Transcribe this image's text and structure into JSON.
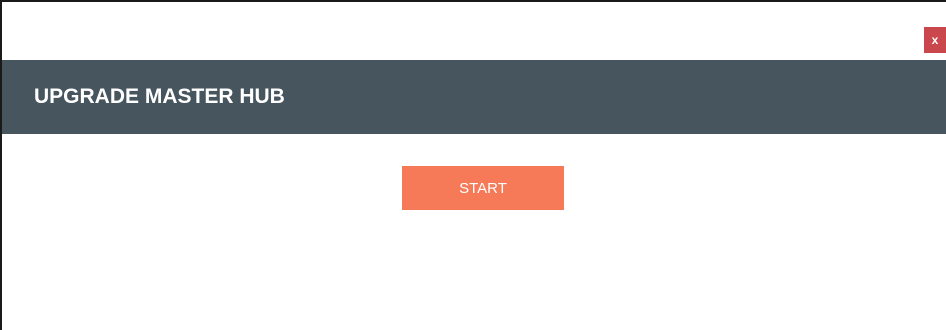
{
  "window": {
    "close_label": "x",
    "close_color": "#c9474d"
  },
  "header": {
    "title": "UPGRADE MASTER HUB",
    "background": "#46555e"
  },
  "main": {
    "start_label": "START",
    "start_color": "#f67a58"
  }
}
